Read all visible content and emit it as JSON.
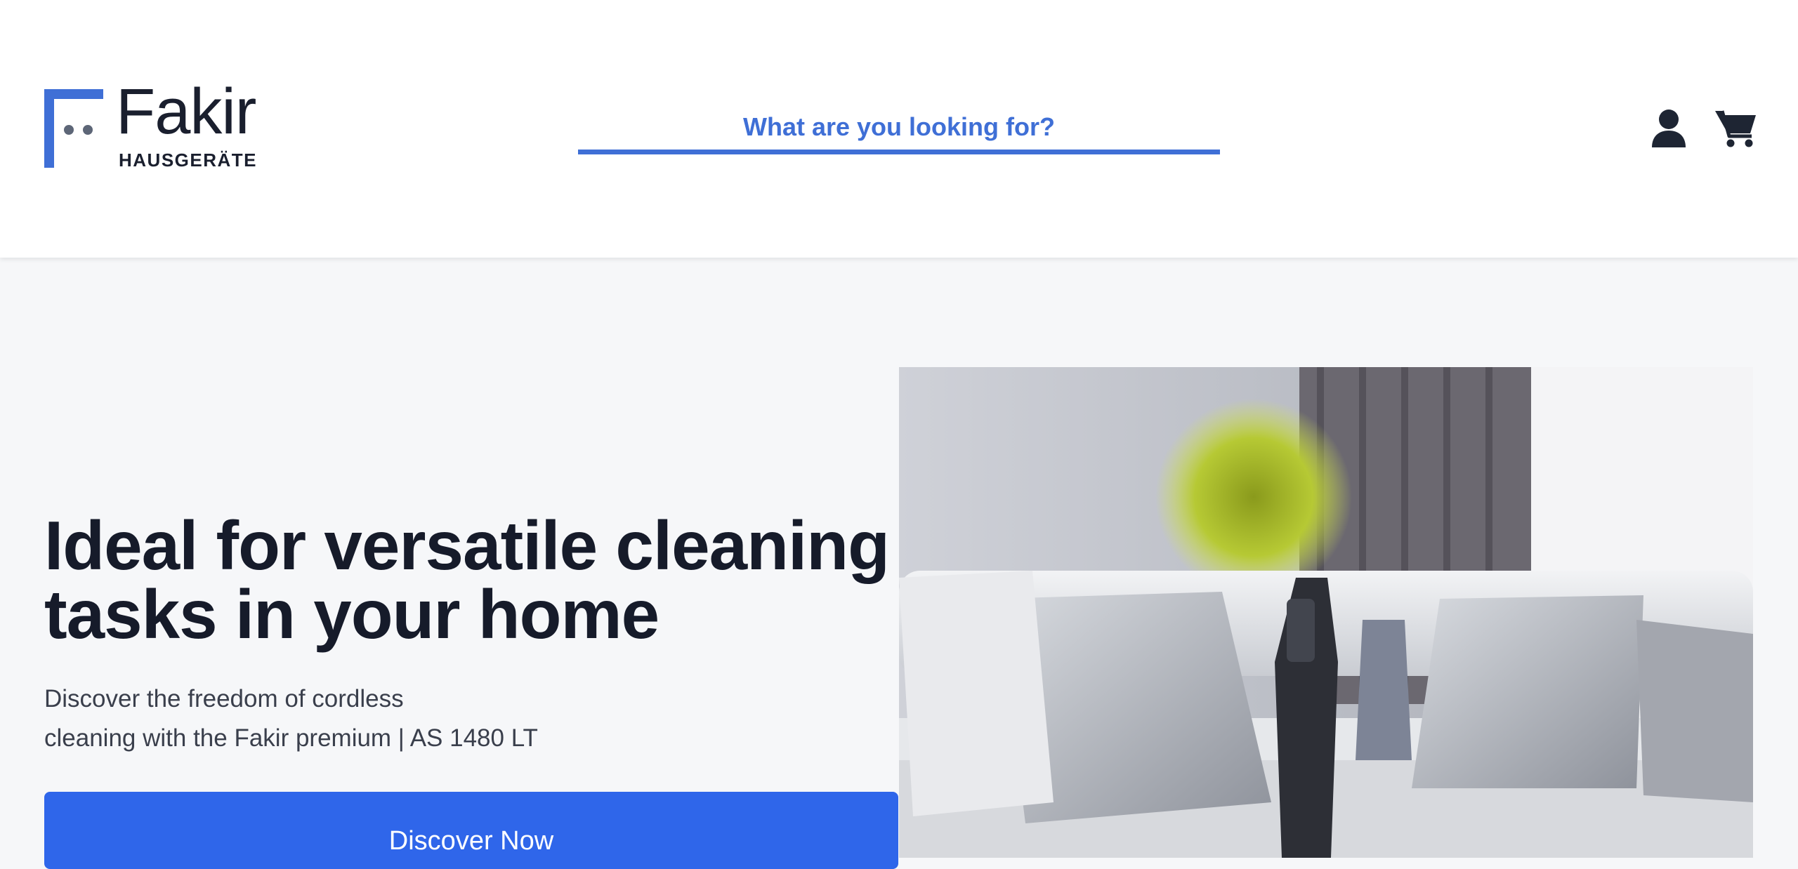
{
  "header": {
    "brand": {
      "name": "Fakir",
      "subtitle": "HAUSGERÄTE"
    },
    "search": {
      "placeholder": "What are you looking for?",
      "value": ""
    },
    "icons": {
      "account": "user-icon",
      "cart": "cart-icon"
    }
  },
  "hero": {
    "title": "Ideal for versatile cleaning tasks in your home",
    "description_lines": [
      "Discover the freedom of cordless",
      "cleaning with the Fakir premium | AS 1480 LT"
    ],
    "cta_label": "Discover Now",
    "image": "living-room-with-cordless-vacuum"
  },
  "colors": {
    "accent": "#3f6fd6",
    "button": "#2f66ea",
    "text_dark": "#161b2a",
    "page_bg": "#f6f7f9"
  }
}
